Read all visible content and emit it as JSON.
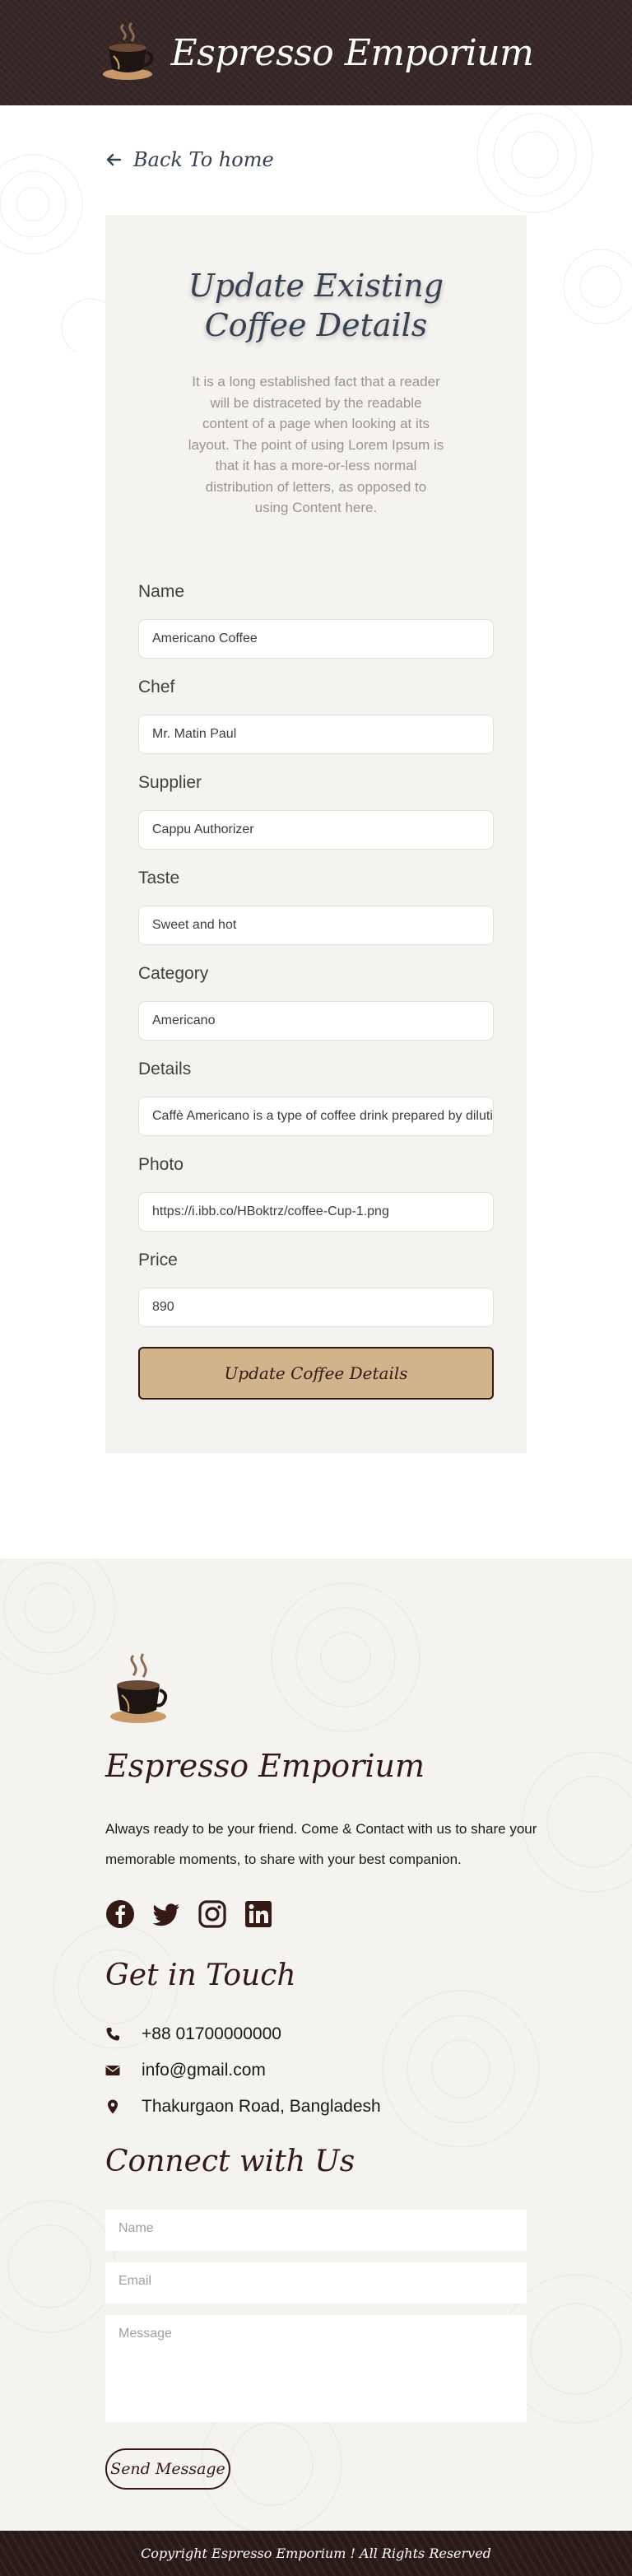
{
  "header": {
    "brand": "Espresso Emporium",
    "logo_icon": "coffee-cup-logo-icon"
  },
  "nav": {
    "back_label": "Back To home"
  },
  "form": {
    "title": "Update Existing Coffee Details",
    "intro": "It is a long established fact that a reader will be distraceted by the readable content of a page when looking at its layout. The point of using Lorem Ipsum is that it has a more-or-less normal distribution of letters, as opposed to using Content here.",
    "fields": [
      {
        "label": "Name",
        "value": "Americano Coffee"
      },
      {
        "label": "Chef",
        "value": "Mr. Matin Paul"
      },
      {
        "label": "Supplier",
        "value": "Cappu Authorizer"
      },
      {
        "label": "Taste",
        "value": "Sweet and hot"
      },
      {
        "label": "Category",
        "value": "Americano"
      },
      {
        "label": "Details",
        "value": "Caffè Americano is a type of coffee drink prepared by diluting an espresso with hot water"
      },
      {
        "label": "Photo",
        "value": "https://i.ibb.co/HBoktrz/coffee-Cup-1.png"
      },
      {
        "label": "Price",
        "value": "890"
      }
    ],
    "submit_label": "Update Coffee Details"
  },
  "footer": {
    "brand": "Espresso Emporium",
    "tagline": "Always ready to be your friend. Come & Contact with us to share your memorable moments, to share with your best companion.",
    "socials": [
      "facebook-icon",
      "twitter-icon",
      "instagram-icon",
      "linkedin-icon"
    ],
    "get_in_touch_title": "Get in Touch",
    "phone": "+88 01700000000",
    "email": "info@gmail.com",
    "address": "Thakurgaon Road, Bangladesh",
    "connect_title": "Connect with Us",
    "name_placeholder": "Name",
    "email_placeholder": "Email",
    "message_placeholder": "Message",
    "send_label": "Send Message"
  },
  "copyright": "Copyright Espresso Emporium ! All Rights Reserved",
  "colors": {
    "header_bg": "#372727",
    "button_bg": "#d2b48c",
    "dark_brown": "#331a15",
    "card_bg": "#f4f3f0"
  }
}
